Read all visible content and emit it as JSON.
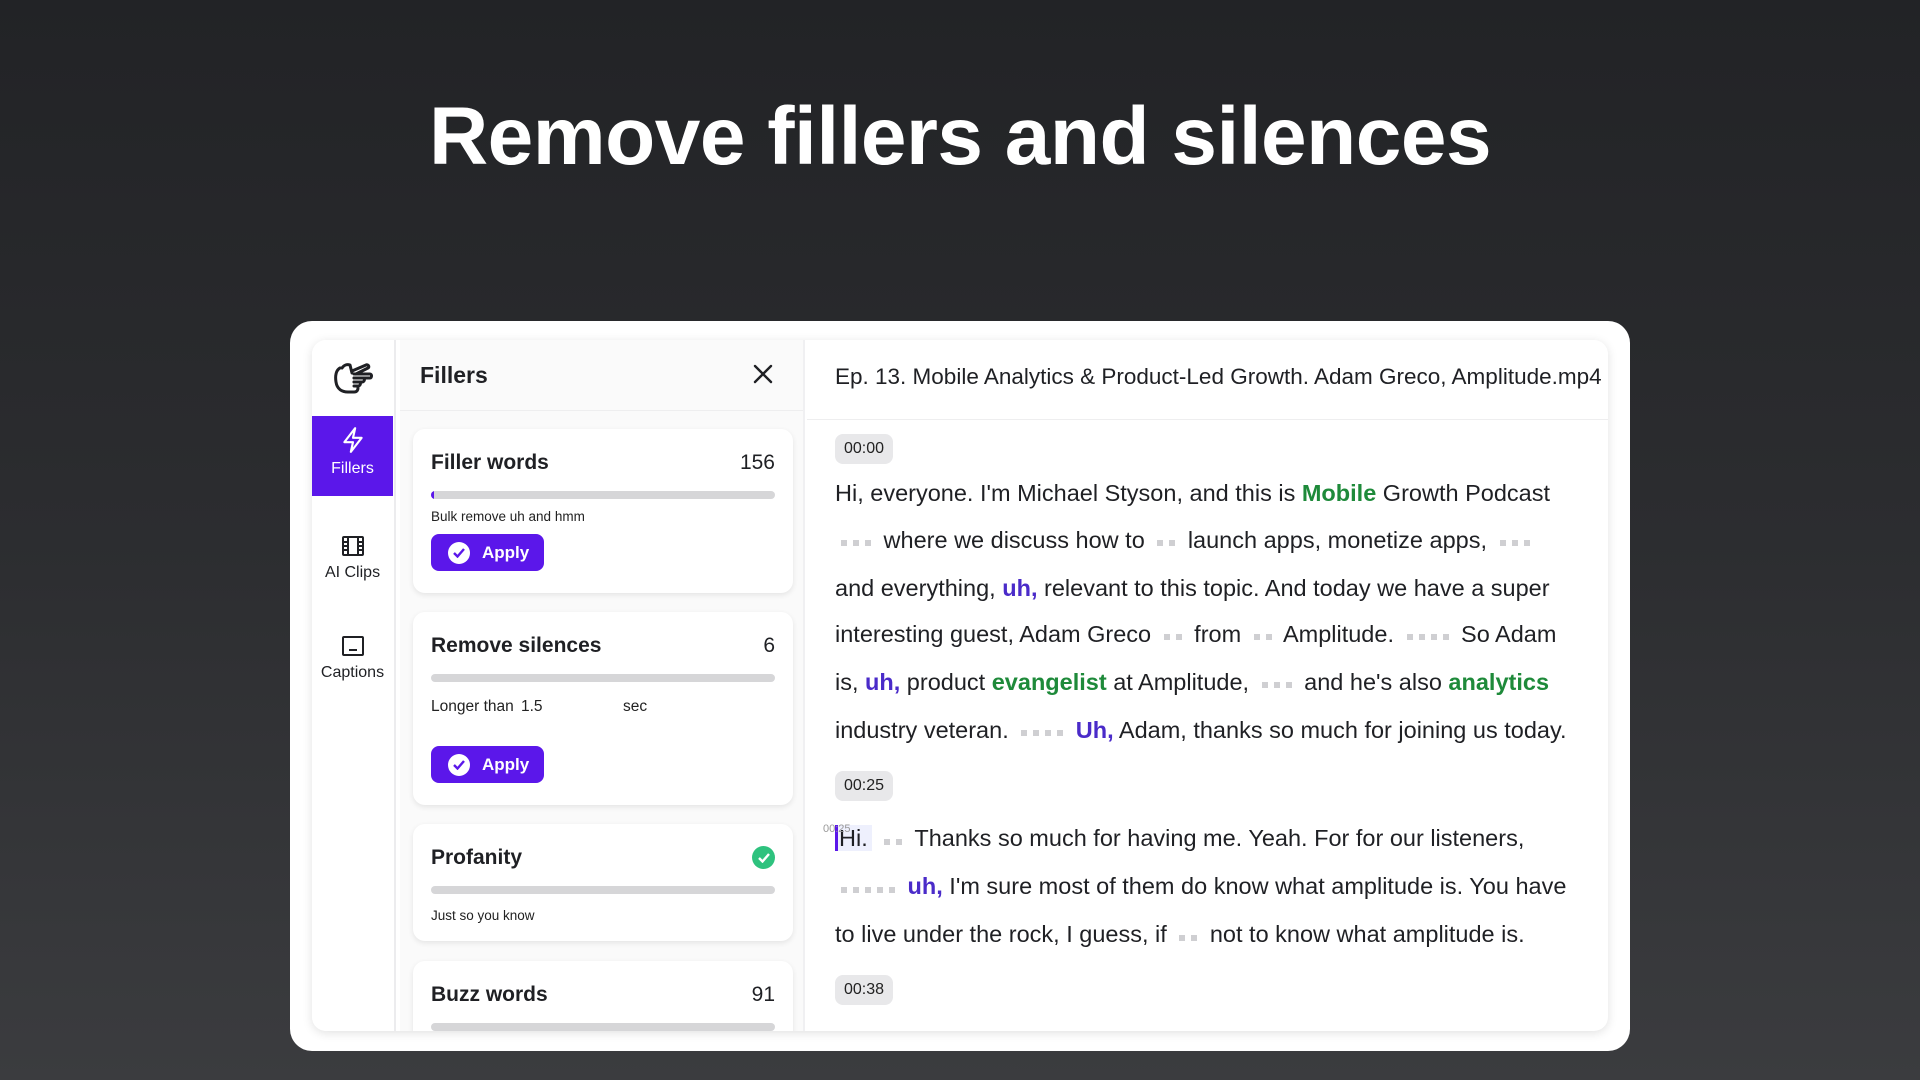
{
  "hero_title": "Remove fillers and silences",
  "colors": {
    "accent": "#5b17ea",
    "filler": "#4a2bc9",
    "buzz": "#1e8a3a",
    "success": "#2ec27e"
  },
  "sidebar": {
    "items": [
      {
        "label": "Fillers",
        "icon": "lightning-icon",
        "active": true
      },
      {
        "label": "AI Clips",
        "icon": "film-icon"
      },
      {
        "label": "Captions",
        "icon": "captions-icon"
      }
    ]
  },
  "panel": {
    "title": "Fillers",
    "cards": [
      {
        "title": "Filler words",
        "count": "156",
        "progress": 0.01,
        "desc": "Bulk remove uh and hmm",
        "button": "Apply"
      },
      {
        "title": "Remove silences",
        "count": "6",
        "progress": 0,
        "longer_label": "Longer than",
        "longer_value": "1.5",
        "unit": "sec",
        "button": "Apply"
      },
      {
        "title": "Profanity",
        "status": "done",
        "progress": 0,
        "desc": "Just so you know"
      },
      {
        "title": "Buzz words",
        "count": "91",
        "progress": 0
      }
    ]
  },
  "transcript": {
    "file_title": "Ep. 13. Mobile Analytics & Product-Led Growth. Adam Greco, Amplitude.mp4",
    "cursor_time": "00:25",
    "segments": [
      {
        "time": "00:00",
        "tokens": [
          {
            "t": "Hi, everyone. I'm Michael Styson, and this is "
          },
          {
            "t": "Mobile",
            "k": "b"
          },
          {
            "t": " Growth Podcast "
          },
          {
            "p": 3
          },
          {
            "t": " where we discuss how to "
          },
          {
            "p": 2
          },
          {
            "t": " launch apps, monetize apps, "
          },
          {
            "p": 3
          },
          {
            "t": " and everything, "
          },
          {
            "t": "uh,",
            "k": "f"
          },
          {
            "t": " relevant to this topic. And today we have a super interesting guest, Adam Greco "
          },
          {
            "p": 2
          },
          {
            "t": " from "
          },
          {
            "p": 2
          },
          {
            "t": " Amplitude. "
          },
          {
            "p": 4
          },
          {
            "t": " So Adam is, "
          },
          {
            "t": "uh,",
            "k": "f"
          },
          {
            "t": " product "
          },
          {
            "t": "evangelist",
            "k": "b"
          },
          {
            "t": " at Amplitude, "
          },
          {
            "p": 3
          },
          {
            "t": " and he's also "
          },
          {
            "t": "analytics",
            "k": "b"
          },
          {
            "t": " industry veteran. "
          },
          {
            "p": 4
          },
          {
            "t": " "
          },
          {
            "t": "Uh,",
            "k": "f"
          },
          {
            "t": " Adam, thanks so much for joining us today."
          }
        ]
      },
      {
        "time": "00:25",
        "tokens": [
          {
            "t": "Hi.",
            "k": "hl"
          },
          {
            "t": " "
          },
          {
            "p": 2
          },
          {
            "t": " Thanks so much for having me. Yeah. For for our listeners, "
          },
          {
            "p": 5
          },
          {
            "t": " "
          },
          {
            "t": "uh,",
            "k": "f"
          },
          {
            "t": " I'm sure most of them do know what amplitude is. You have to live under the rock, I guess, if "
          },
          {
            "p": 2
          },
          {
            "t": " not to know what amplitude is."
          }
        ]
      },
      {
        "time": "00:38",
        "tokens": []
      }
    ]
  }
}
